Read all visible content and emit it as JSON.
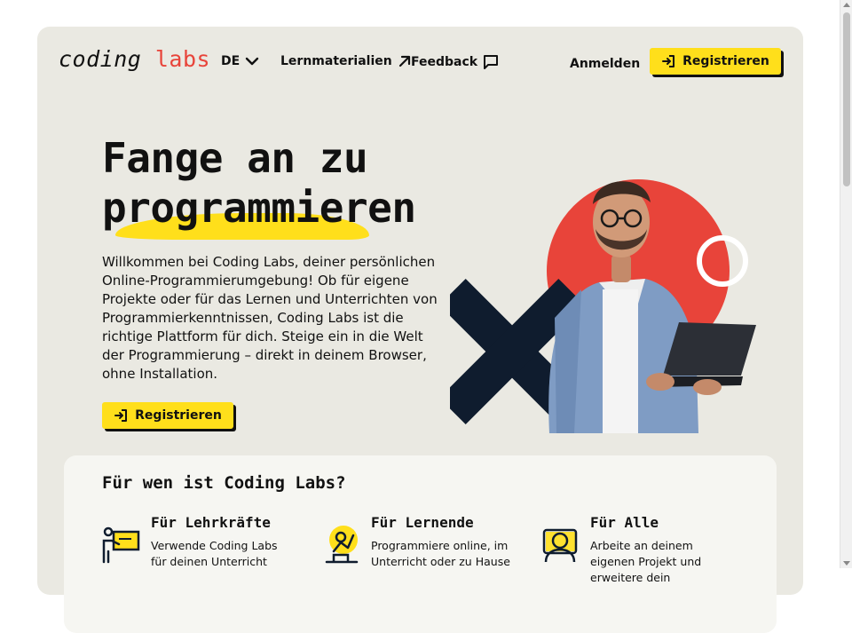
{
  "header": {
    "logo_part1": "coding",
    "logo_part2": "labs",
    "language": "DE",
    "nav": {
      "materials": "Lernmaterialien",
      "feedback": "Feedback"
    },
    "login": "Anmelden",
    "register": "Registrieren"
  },
  "hero": {
    "title_line1": "Fange an zu",
    "title_line2": "programmieren",
    "text": "Willkommen bei Coding Labs, deiner persönlichen Online-Programmierumgebung! Ob für eigene Projekte oder für das Lernen und Unterrichten von Programmierkenntnissen, Coding Labs ist die richtige Plattform für dich. Steige ein in die Welt der Programmierung – direkt in deinem Browser, ohne Installation.",
    "cta": "Registrieren"
  },
  "audience": {
    "title": "Für wen ist Coding Labs?",
    "items": [
      {
        "title": "Für Lehrkräfte",
        "text": "Verwende Coding Labs für deinen Unterricht",
        "icon": "teacher-icon"
      },
      {
        "title": "Für Lernende",
        "text": "Programmiere online, im Unterricht oder zu Hause",
        "icon": "learner-icon"
      },
      {
        "title": "Für Alle",
        "text": "Arbeite an deinem eigenen Projekt und erweitere dein",
        "icon": "person-icon"
      }
    ]
  },
  "colors": {
    "background": "#eae9e2",
    "accent_yellow": "#ffdf1b",
    "accent_red": "#e8443a",
    "dark_navy": "#0f1c2e"
  }
}
